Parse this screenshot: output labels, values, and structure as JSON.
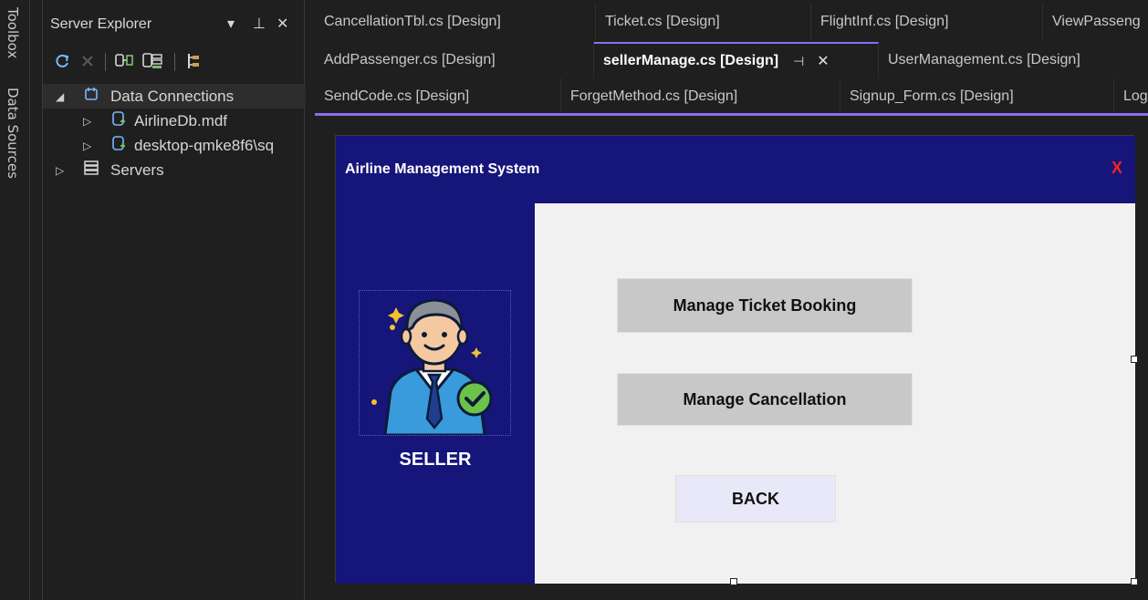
{
  "side_strip": {
    "toolbox": "Toolbox",
    "data_sources": "Data Sources"
  },
  "server_explorer": {
    "title": "Server Explorer",
    "controls": {
      "dropdown": "▾",
      "pin": "⊥",
      "close": "✕"
    },
    "tree": [
      {
        "label": "Data Connections",
        "expanded": true
      },
      {
        "label": "AirlineDb.mdf"
      },
      {
        "label": "desktop-qmke8f6\\sq"
      },
      {
        "label": "Servers"
      }
    ]
  },
  "tabs": {
    "row1": [
      "CancellationTbl.cs [Design]",
      "Ticket.cs [Design]",
      "FlightInf.cs [Design]",
      "ViewPasseng"
    ],
    "row2": [
      "AddPassenger.cs [Design]",
      "sellerManage.cs [Design]",
      "UserManagement.cs [Design]"
    ],
    "row3": [
      "SendCode.cs [Design]",
      "ForgetMethod.cs [Design]",
      "Signup_Form.cs [Design]",
      "Log"
    ],
    "active_pin": "⊣",
    "active_close": "✕"
  },
  "form": {
    "title": "Airline Management System",
    "close": "X",
    "role_label": "SELLER",
    "buttons": {
      "manage_ticket": "Manage Ticket Booking",
      "manage_cancellation": "Manage Cancellation",
      "back": "BACK"
    }
  },
  "colors": {
    "accent": "#8a6df0",
    "form_navy": "#15157a",
    "close_red": "#ff2020",
    "button_gray": "#c8c8c8"
  }
}
